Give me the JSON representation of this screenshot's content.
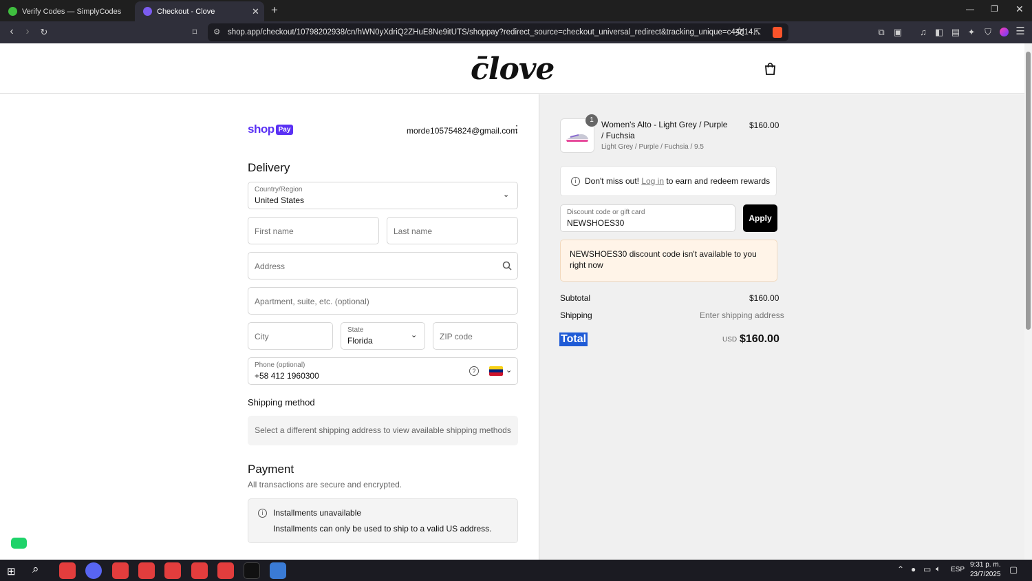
{
  "browser": {
    "tabs": [
      {
        "title": "Verify Codes — SimplyCodes"
      },
      {
        "title": "Checkout - Clove"
      }
    ],
    "url": "shop.app/checkout/10798202938/cn/hWN0yXdriQ2ZHuE8Ne9itUTS/shoppay?redirect_source=checkout_universal_redirect&tracking_unique=c44d14..."
  },
  "store": {
    "logo_text": "c̄love"
  },
  "shop_pay": {
    "brand": "shop",
    "badge": "Pay",
    "email": "morde105754824@gmail.com"
  },
  "delivery": {
    "title": "Delivery",
    "country_label": "Country/Region",
    "country_value": "United States",
    "first_name_ph": "First name",
    "last_name_ph": "Last name",
    "address_ph": "Address",
    "apartment_ph": "Apartment, suite, etc. (optional)",
    "city_ph": "City",
    "state_label": "State",
    "state_value": "Florida",
    "zip_ph": "ZIP code",
    "phone_label": "Phone (optional)",
    "phone_value": "+58 412 1960300"
  },
  "shipping_method": {
    "title": "Shipping method",
    "message": "Select a different shipping address to view available shipping methods"
  },
  "payment": {
    "title": "Payment",
    "subtitle": "All transactions are secure and encrypted.",
    "notice_title": "Installments unavailable",
    "notice_body": "Installments can only be used to ship to a valid US address."
  },
  "order": {
    "item_qty": "1",
    "item_name": "Women's Alto - Light Grey / Purple / Fuchsia",
    "item_variant": "Light Grey / Purple / Fuchsia / 9.5",
    "item_price": "$160.00",
    "rewards_pre": "Don't miss out!",
    "rewards_link": "Log in",
    "rewards_post": "to earn and redeem rewards",
    "discount_label": "Discount code or gift card",
    "discount_value": "NEWSHOES30",
    "apply_label": "Apply",
    "error_msg": "NEWSHOES30 discount code isn't available to you right now",
    "subtotal_label": "Subtotal",
    "subtotal_value": "$160.00",
    "shipping_label": "Shipping",
    "shipping_value": "Enter shipping address",
    "total_label": "Total",
    "total_currency": "USD",
    "total_value": "$160.00"
  },
  "taskbar": {
    "lang": "ESP",
    "time": "9:31 p. m.",
    "date": "23/7/2025"
  },
  "colors": {
    "shop_purple": "#5a31f4",
    "error_bg": "#fff4e8",
    "accent": "#000000"
  }
}
